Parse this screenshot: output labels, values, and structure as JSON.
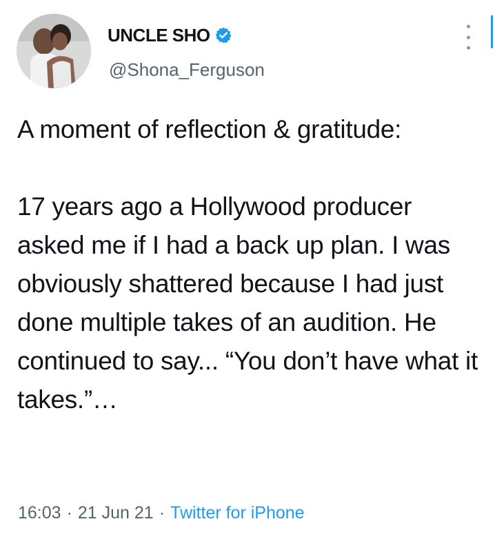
{
  "author": {
    "display_name": "UNCLE SHO",
    "handle": "@Shona_Ferguson",
    "verified_icon": "verified-badge-icon"
  },
  "tweet": {
    "text": "A moment of reflection & gratitude:\n\n17 years ago a Hollywood producer asked me if I had a back up plan. I was obviously shattered because I had just done multiple takes of an audition. He continued to say... “You don’t have what it takes.”…",
    "time": "16:03",
    "separator": "·",
    "date": "21 Jun 21",
    "source": "Twitter for iPhone"
  },
  "colors": {
    "accent": "#1d9bf0",
    "secondary_text": "#536471",
    "primary_text": "#0f1419"
  }
}
